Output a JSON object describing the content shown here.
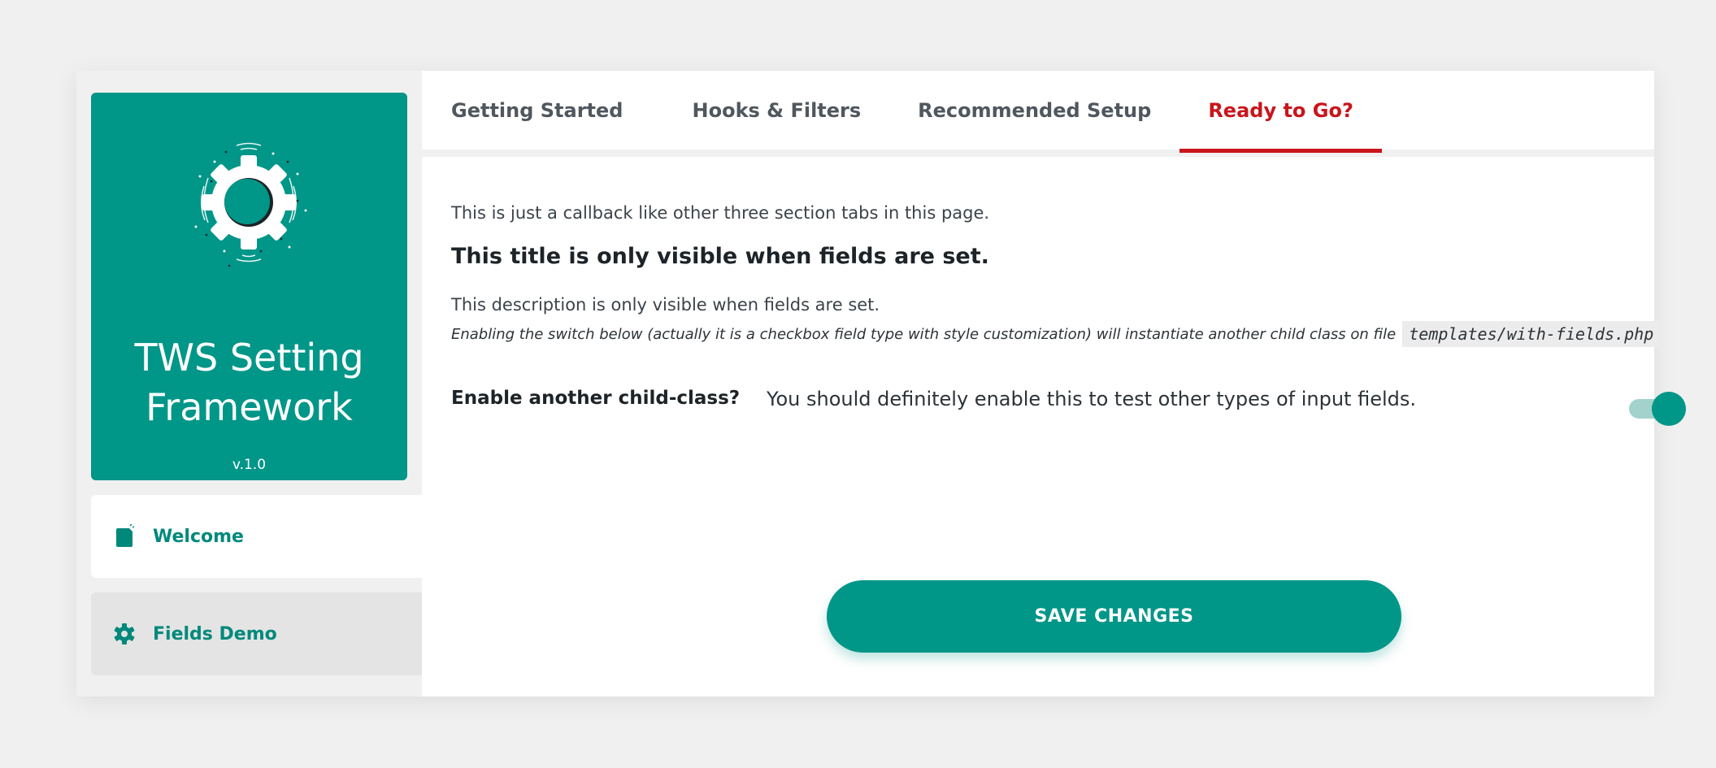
{
  "sidebar": {
    "brand": {
      "title_line1": "TWS Setting",
      "title_line2": "Framework",
      "version": "v.1.0",
      "logo_icon": "gear-icon"
    },
    "items": [
      {
        "label": "Welcome",
        "icon": "document-icon",
        "active": true
      },
      {
        "label": "Fields Demo",
        "icon": "gear-icon",
        "active": false
      }
    ]
  },
  "tabs": [
    {
      "label": "Getting Started",
      "active": false
    },
    {
      "label": "Hooks & Filters",
      "active": false
    },
    {
      "label": "Recommended Setup",
      "active": false
    },
    {
      "label": "Ready to Go?",
      "active": true
    }
  ],
  "content": {
    "intro": "This is just a callback like other three section tabs in this page.",
    "section_title": "This title is only visible when fields are set.",
    "section_desc": "This description is only visible when fields are set.",
    "section_note": "Enabling the switch below (actually it is a checkbox field type with style customization) will instantiate another child class on file",
    "section_note_code": "templates/with-fields.php",
    "field": {
      "label": "Enable another child-class?",
      "description": "You should definitely enable this to test other types of input fields.",
      "checked": true
    },
    "save_label": "SAVE CHANGES"
  },
  "colors": {
    "accent": "#009688",
    "active_tab": "#c9151b",
    "background": "#f0f0f0"
  }
}
